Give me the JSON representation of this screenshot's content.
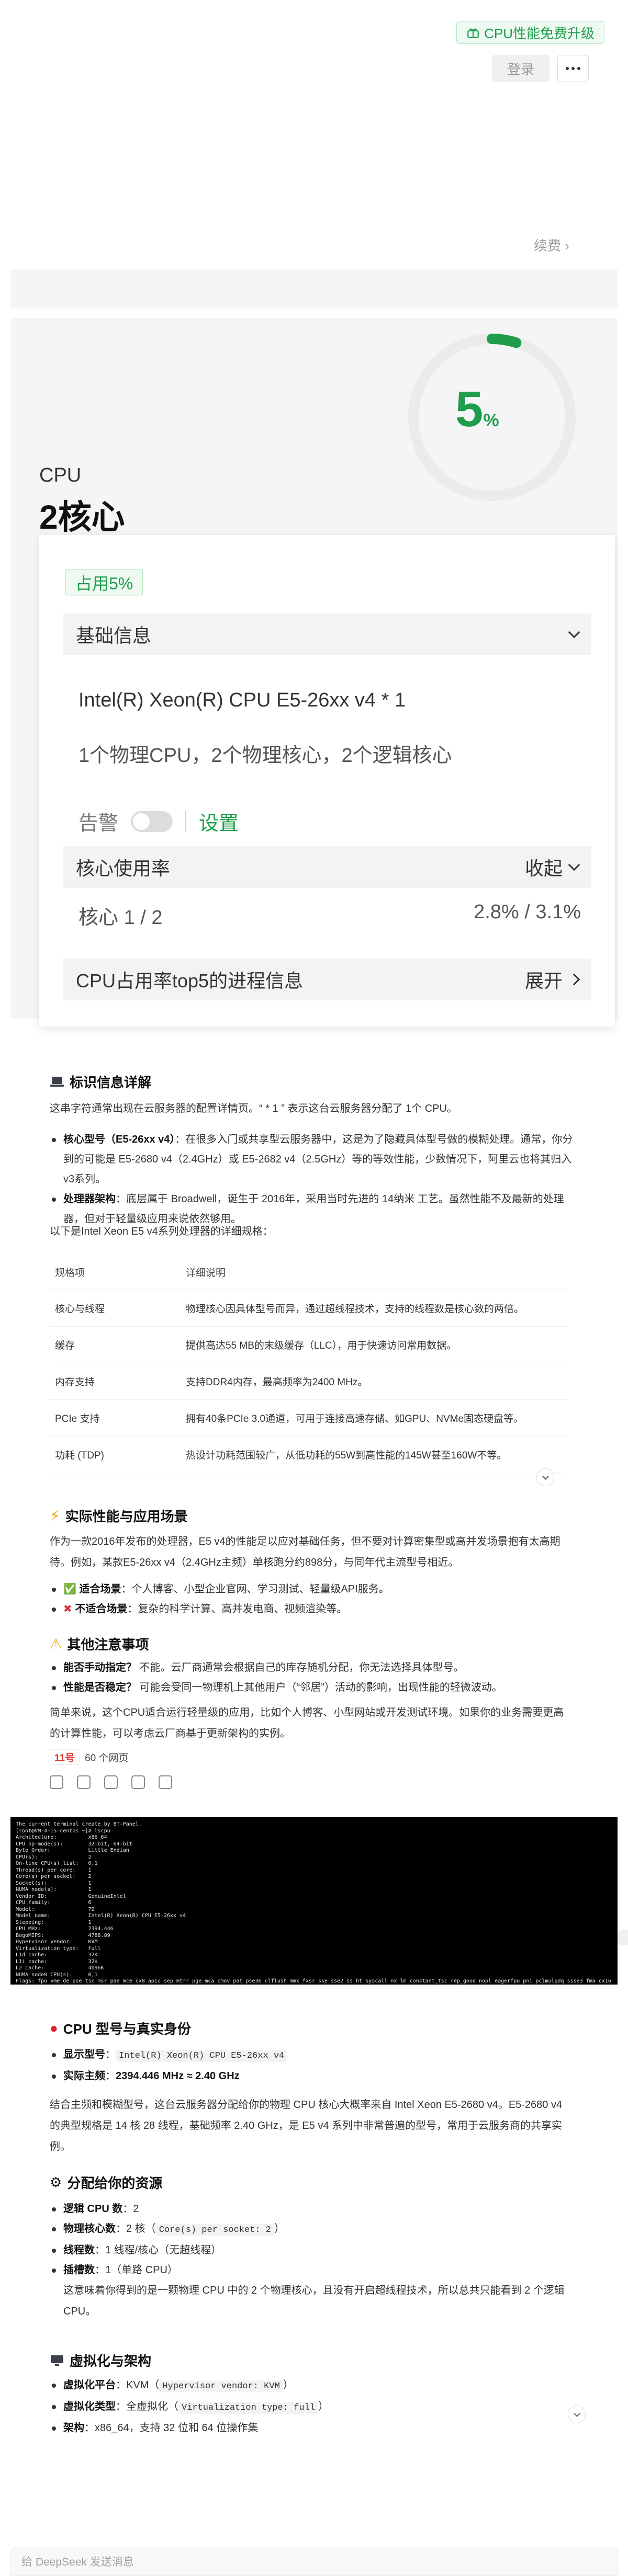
{
  "header": {
    "upgrade_label": "CPU性能免费升级",
    "login_label": "登录",
    "renew_label": "续费 ›"
  },
  "cpu": {
    "usage_percent": 5,
    "usage_unit": "%",
    "label": "CPU",
    "cores": "2核心",
    "usage_tag": "占用5%",
    "basic_info_label": "基础信息",
    "model": "Intel(R) Xeon(R) CPU E5-26xx v4 * 1",
    "desc": "1个物理CPU，2个物理核心，2个逻辑核心",
    "alarm_label": "告警",
    "settings_label": "设置",
    "core_usage_label": "核心使用率",
    "collapse_label": "收起",
    "core_page": "核心 1 / 2",
    "core_values": "2.8% / 3.1%",
    "top5_label": "CPU占用率top5的进程信息",
    "expand_label": "展开"
  },
  "answer1": {
    "title": "标识信息详解",
    "intro": "这串字符通常出现在云服务器的配置详情页。“ * 1 ” 表示这台云服务器分配了 1个 CPU。",
    "bullets": [
      {
        "b": "核心型号（E5-26xx v4）",
        "t": "：在很多入门或共享型云服务器中，这是为了隐藏具体型号做的模糊处理。通常，你分到的可能是 E5-2680 v4（2.4GHz）或 E5-2682 v4（2.5GHz）等的等效性能，少数情况下，阿里云也将其归入v3系列。"
      },
      {
        "b": "处理器架构",
        "t": "：底层属于 Broadwell，诞生于 2016年，采用当时先进的 14纳米 工艺。虽然性能不及最新的处理器，但对于轻量级应用来说依然够用。"
      }
    ],
    "table_intro": "以下是Intel Xeon E5 v4系列处理器的详细规格：",
    "table_headers": [
      "规格项",
      "详细说明"
    ],
    "table_rows": [
      [
        "核心与线程",
        "物理核心因具体型号而异，通过超线程技术，支持的线程数是核心数的两倍。"
      ],
      [
        "缓存",
        "提供高达55 MB的末级缓存（LLC），用于快速访问常用数据。"
      ],
      [
        "内存支持",
        "支持DDR4内存，最高频率为2400 MHz。"
      ],
      [
        "PCIe 支持",
        "拥有40条PCIe 3.0通道，可用于连接高速存储、如GPU、NVMe固态硬盘等。"
      ],
      [
        "功耗 (TDP)",
        "热设计功耗范围较广，从低功耗的55W到高性能的145W甚至160W不等。"
      ]
    ],
    "perf_title": "实际性能与应用场景",
    "perf_text": "作为一款2016年发布的处理器，E5 v4的性能足以应对基础任务，但不要对计算密集型或高并发场景抱有太高期待。例如，某款E5-26xx v4（2.4GHz主频）单核跑分约898分，与同年代主流型号相近。",
    "perf_bullets": [
      {
        "b": "适合场景",
        "t": "：个人博客、小型企业官网、学习测试、轻量级API服务。"
      },
      {
        "b": "不适合场景",
        "t": "：复杂的科学计算、高并发电商、视频渲染等。"
      }
    ],
    "note_title": "其他注意事项",
    "note_bullets": [
      {
        "b": "能否手动指定？",
        "t": " 不能。云厂商通常会根据自己的库存随机分配，你无法选择具体型号。"
      },
      {
        "b": "性能是否稳定？",
        "t": " 可能会受同一物理机上其他用户（“邻居”）活动的影响，出现性能的轻微波动。"
      }
    ],
    "summary": "简单来说，这个CPU适合运行轻量级的应用，比如个人博客、小型网站或开发测试环境。如果你的业务需要更高的计算性能，可以考虑云厂商基于更新架构的实例。",
    "source_logo": "11号",
    "source_count": "60 个网页"
  },
  "terminal": {
    "lines": [
      "The current terminal create by BT-Panel.",
      "[root@VM-4-15-centos ~]# lscpu",
      "Architecture:          x86_64",
      "CPU op-mode(s):        32-bit, 64-bit",
      "Byte Order:            Little Endian",
      "CPU(s):                2",
      "On-line CPU(s) list:   0,1",
      "Thread(s) per core:    1",
      "Core(s) per socket:    2",
      "Socket(s):             1",
      "NUMA node(s):          1",
      "Vendor ID:             GenuineIntel",
      "CPU family:            6",
      "Model:                 79",
      "Model name:            Intel(R) Xeon(R) CPU E5-26xx v4",
      "Stepping:              1",
      "CPU MHz:               2394.446",
      "BogoMIPS:              4788.89",
      "Hypervisor vendor:     KVM",
      "Virtualization type:   full",
      "L1d cache:             32K",
      "L1i cache:             32K",
      "L2 cache:              4096K",
      "NUMA node0 CPU(s):     0,1",
      "Flags:                 fpu vme de pse tsc msr pae mce cx8 apic sep mtrr pge mca cmov pat pse36 clflush mmx fxsr sse sse2 ss ht syscall nx lm constant_tsc rep_good nopl eagerfpu pni pclmulqdq ssse3 fma cx16 pcid sse4_1 sse4_2 x2apic movbe popcnt tsc_deadline_timer aes xsave avx f16c rdrand hypervisor lahf_lm abm 3dnowprefetch bmi1 avx2 bmi2 rdseed adx xsaveopt",
      "[root@VM-4-15-centos ~]# "
    ]
  },
  "answer2": {
    "model_title": "CPU 型号与真实身份",
    "model_bullets": [
      {
        "b": "显示型号",
        "code": "Intel(R) Xeon(R) CPU E5-26xx v4"
      },
      {
        "b": "实际主频",
        "t": "2394.446 MHz ≈ 2.40 GHz"
      }
    ],
    "model_text": "结合主频和模糊型号，这台云服务器分配给你的物理 CPU 核心大概率来自 Intel Xeon E5-2680 v4。E5-2680 v4 的典型规格是 14 核 28 线程，基础频率 2.40 GHz，是 E5 v4 系列中非常普遍的型号，常用于云服务商的共享实例。",
    "res_title": "分配给你的资源",
    "res_bullets": [
      {
        "b": "逻辑 CPU 数",
        "t": "：2"
      },
      {
        "b": "物理核心数",
        "t": "：2 核（",
        "code": "Core(s) per socket: 2",
        "t2": "）"
      },
      {
        "b": "线程数",
        "t": "：1 线程/核心（无超线程）"
      },
      {
        "b": "插槽数",
        "t": "：1（单路 CPU）"
      }
    ],
    "res_text": "这意味着你得到的是一颗物理 CPU 中的 2 个物理核心，且没有开启超线程技术，所以总共只能看到 2 个逻辑 CPU。",
    "virt_title": "虚拟化与架构",
    "virt_bullets": [
      {
        "b": "虚拟化平台",
        "t": "：KVM（",
        "code": "Hypervisor vendor: KVM",
        "t2": "）"
      },
      {
        "b": "虚拟化类型",
        "t": "：全虚拟化（",
        "code": "Virtualization type: full",
        "t2": "）"
      },
      {
        "b": "架构",
        "t": "：x86_64，支持 32 位和 64 位操作集"
      }
    ]
  },
  "input": {
    "placeholder": "给 DeepSeek 发送消息"
  },
  "colors": {
    "accent_green": "#1f9d4c",
    "panel_bg": "#f5f5f7"
  }
}
